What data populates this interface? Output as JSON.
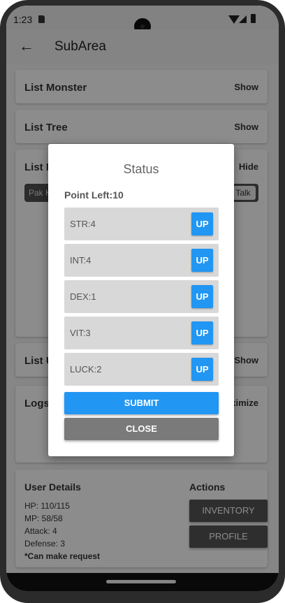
{
  "status_bar": {
    "time": "1:23",
    "icons": [
      "sd-card-icon",
      "wifi-icon",
      "signal-icon",
      "battery-icon"
    ]
  },
  "app_bar": {
    "back_icon": "arrow-back-icon",
    "title": "SubArea"
  },
  "sections": {
    "monsters": {
      "title": "List Monster",
      "action": "Show"
    },
    "trees": {
      "title": "List Tree",
      "action": "Show"
    },
    "npc": {
      "title": "List N",
      "action": "Hide",
      "row_name": "Pak K",
      "row_talk": "Talk"
    },
    "users": {
      "title": "List U",
      "action": "Show"
    },
    "logs": {
      "title": "Logs",
      "action": "ximize"
    }
  },
  "user_details": {
    "title": "User Details",
    "hp": "HP: 110/115",
    "mp": "MP: 58/58",
    "attack": "Attack: 4",
    "defense": "Defense: 3",
    "note": "*Can make request"
  },
  "actions": {
    "title": "Actions",
    "inventory": "INVENTORY",
    "profile": "PROFILE"
  },
  "dialog": {
    "title": "Status",
    "points": "Point Left:10",
    "stats": [
      {
        "label": "STR:4",
        "button": "UP"
      },
      {
        "label": "INT:4",
        "button": "UP"
      },
      {
        "label": "DEX:1",
        "button": "UP"
      },
      {
        "label": "VIT:3",
        "button": "UP"
      },
      {
        "label": "LUCK:2",
        "button": "UP"
      }
    ],
    "submit": "SUBMIT",
    "close": "CLOSE"
  },
  "colors": {
    "primary": "#2196f3",
    "close_button": "#7a7a7a",
    "scrim": "rgba(0,0,0,0.45)"
  }
}
